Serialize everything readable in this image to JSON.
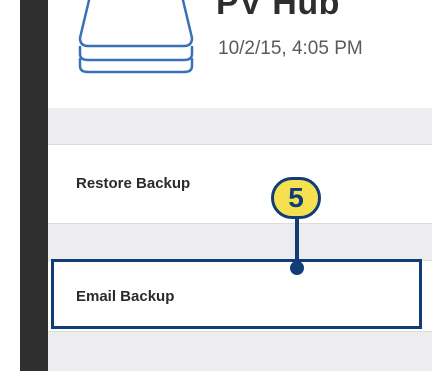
{
  "hub": {
    "title": "PV Hub",
    "date": "10/2/15, 4:05 PM",
    "icon": "hub-stack-icon"
  },
  "menu": {
    "items": [
      {
        "label": "Restore Backup"
      },
      {
        "label": "Email Backup"
      }
    ]
  },
  "callout": {
    "number": "5"
  },
  "colors": {
    "bezel": "#2f2f2f",
    "section_band": "#ededef",
    "highlight": "#123c78",
    "badge_fill": "#f5e14f"
  }
}
